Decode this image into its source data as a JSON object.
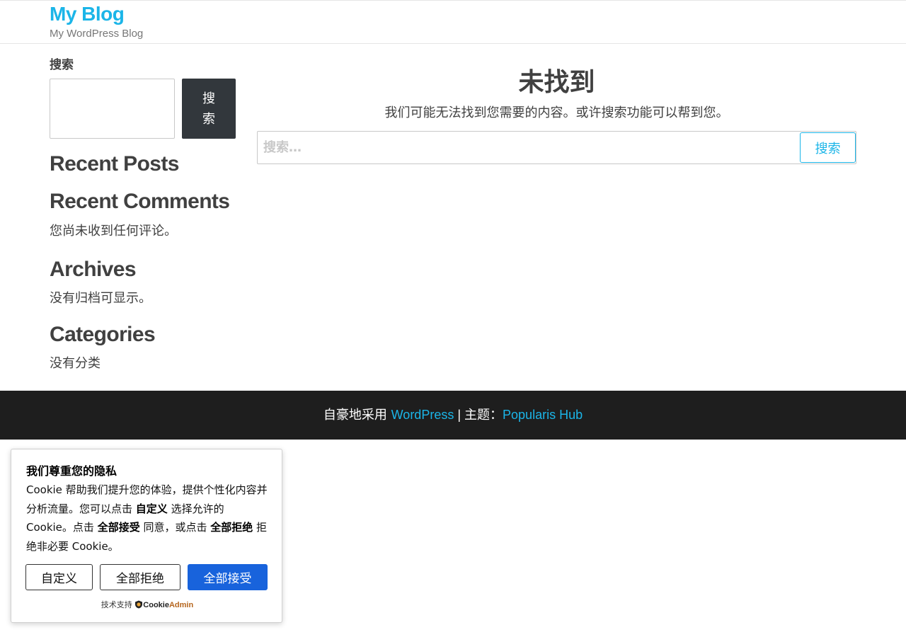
{
  "header": {
    "site_title": "My Blog",
    "site_description": "My WordPress Blog"
  },
  "sidebar": {
    "search_label": "搜索",
    "search_button_line1": "搜",
    "search_button_line2": "索",
    "recent_posts_title": "Recent Posts",
    "recent_comments_title": "Recent Comments",
    "recent_comments_text": "您尚未收到任何评论。",
    "archives_title": "Archives",
    "archives_text": "没有归档可显示。",
    "categories_title": "Categories",
    "categories_text": "没有分类"
  },
  "main": {
    "title": "未找到",
    "description": "我们可能无法找到您需要的内容。或许搜索功能可以帮到您。",
    "search_placeholder": "搜索…",
    "search_button": "搜索"
  },
  "footer": {
    "prefix": "自豪地采用 ",
    "wordpress_link": "WordPress",
    "separator": " | ",
    "theme_label": "主题：",
    "theme_link": "Popularis Hub"
  },
  "cookie_banner": {
    "title": "我们尊重您的隐私",
    "body_part1": "Cookie 帮助我们提升您的体验，提供个性化内容并分析流量。您可以点击 ",
    "customize_word": "自定义",
    "body_part2": " 选择允许的 Cookie。点击 ",
    "accept_word": "全部接受",
    "body_part3": " 同意，或点击 ",
    "reject_word": "全部拒绝",
    "body_part4": " 拒绝非必要 Cookie。",
    "customize_button": "自定义",
    "reject_button": "全部拒绝",
    "accept_button": "全部接受",
    "powered_by": "技术支持",
    "brand_part1": "Cookie",
    "brand_part2": "Admin"
  },
  "colors": {
    "accent": "#1bb5e8",
    "footer_bg": "#1e1e1e",
    "dark_button": "#32373c",
    "accept_button": "#1863dc"
  }
}
